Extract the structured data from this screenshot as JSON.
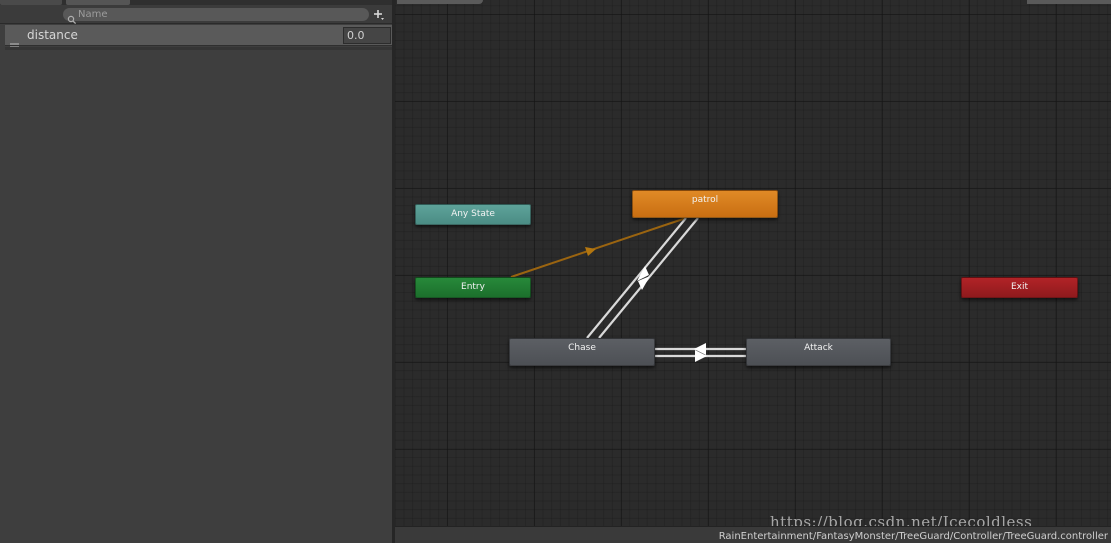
{
  "parameters_panel": {
    "search": {
      "placeholder": "Name"
    },
    "parameters": [
      {
        "name": "distance",
        "value": "0.0"
      }
    ]
  },
  "graph": {
    "states": {
      "any_state": "Any State",
      "entry": "Entry",
      "exit": "Exit",
      "patrol": "patrol",
      "chase": "Chase",
      "attack": "Attack"
    }
  },
  "status_bar": {
    "path": "RainEntertainment/FantasyMonster/TreeGuard/Controller/TreeGuard.controller"
  },
  "watermark": "https://blog.csdn.net/Icecoldless",
  "colors": {
    "default_state": "#c96e12",
    "entry": "#1c6f2c",
    "any_state": "#4b8c84",
    "exit": "#8f1a1d",
    "state": "#4d5055",
    "default_transition": "#9a6410"
  }
}
